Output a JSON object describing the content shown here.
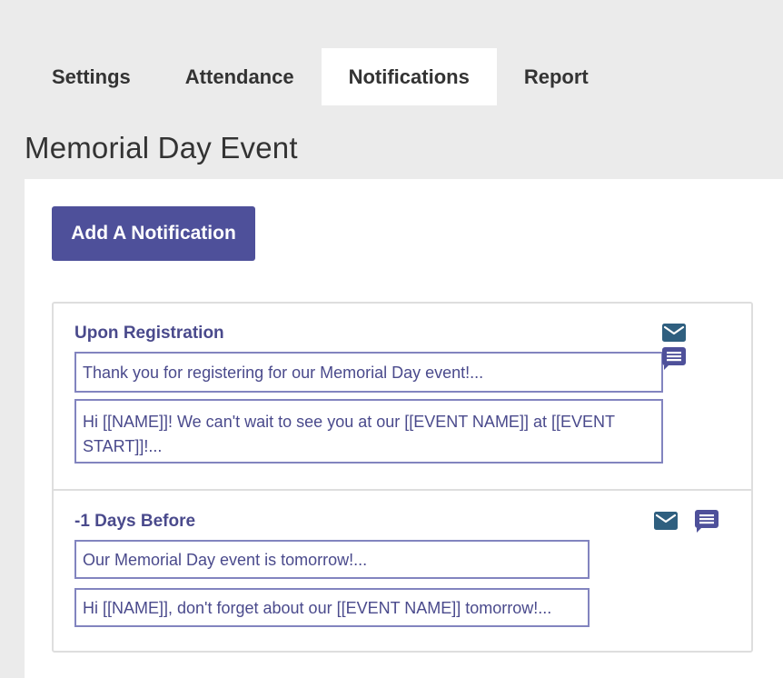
{
  "tabs": [
    {
      "label": "Settings",
      "active": false
    },
    {
      "label": "Attendance",
      "active": false
    },
    {
      "label": "Notifications",
      "active": true
    },
    {
      "label": "Report",
      "active": false
    }
  ],
  "page": {
    "title": "Memorial Day Event",
    "add_button_label": "Add A Notification"
  },
  "notifications": [
    {
      "timing": "Upon Registration",
      "email_subject": "Thank you for registering for our Memorial Day event!...",
      "text_message": "Hi [[NAME]]! We can't wait to see you at our [[EVENT NAME]] at [[EVENT START]]!...",
      "icons": [
        "email-icon",
        "sms-icon"
      ]
    },
    {
      "timing": "-1 Days Before",
      "email_subject": "Our Memorial Day event is tomorrow!...",
      "text_message": "Hi [[NAME]], don't forget about our [[EVENT NAME]] tomorrow!...",
      "icons": [
        "email-icon",
        "sms-icon"
      ]
    }
  ],
  "colors": {
    "accent": "#4e509a",
    "email_icon": "#2f5f7f",
    "sms_icon": "#4e509a",
    "field_border": "#8284bf",
    "text_primary": "#4a4a8c"
  }
}
